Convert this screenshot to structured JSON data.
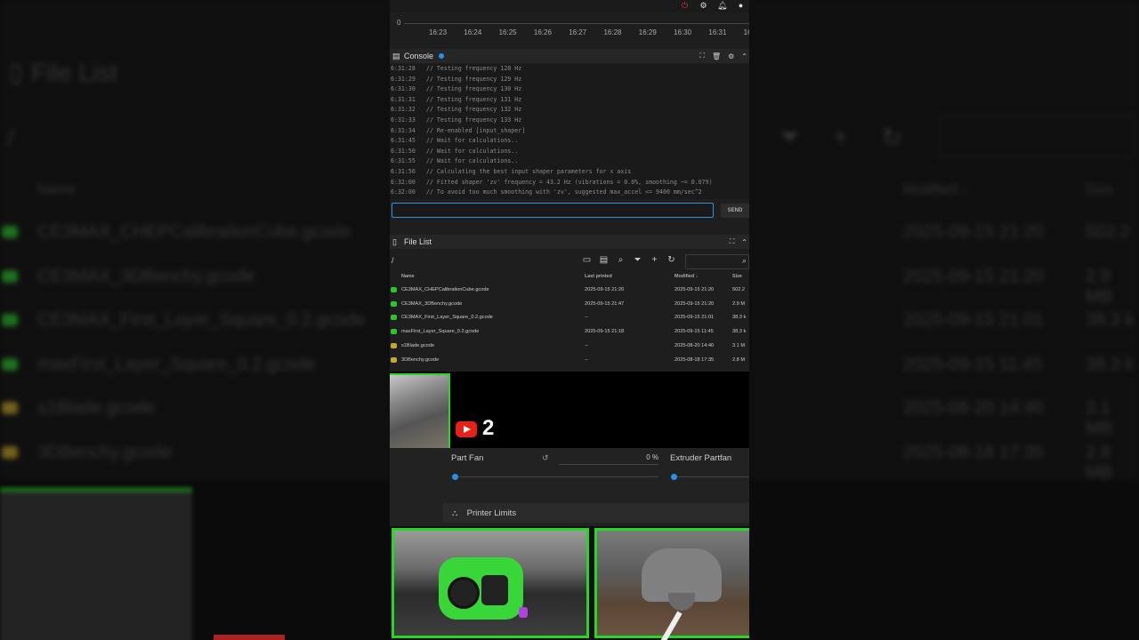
{
  "background": {
    "title": "File List",
    "path": "/",
    "header": {
      "name": "Name",
      "modified": "Modified ↓",
      "size": "Size"
    },
    "rows": [
      {
        "name": "CE3MAX_CHEPCalibrationCube.gcode",
        "modified": "2025-09-15 21:20",
        "size": "502.2",
        "color": "#2ec42e"
      },
      {
        "name": "CE3MAX_3DBenchy.gcode",
        "modified": "2025-09-15 21:20",
        "size": "2.9 MB",
        "color": "#2ec42e"
      },
      {
        "name": "CE3MAX_First_Layer_Square_0.2.gcode",
        "modified": "2025-09-15 21:01",
        "size": "38.3 k",
        "color": "#2ec42e"
      },
      {
        "name": "maxFirst_Layer_Square_0.2.gcode",
        "modified": "2025-09-15 11:45",
        "size": "38.3 k",
        "color": "#2ec42e"
      },
      {
        "name": "s1Blade.gcode",
        "modified": "2025-08-20 14:40",
        "size": "3.1 MB",
        "color": "#c8a82a"
      },
      {
        "name": "3DBenchy.gcode",
        "modified": "2025-08-18 17:35",
        "size": "2.8 MB",
        "color": "#c8a82a"
      }
    ]
  },
  "timeline": {
    "zero": "0",
    "labels": [
      "16:23",
      "16:24",
      "16:25",
      "16:26",
      "16:27",
      "16:28",
      "16:29",
      "16:30",
      "16:31",
      "16:"
    ]
  },
  "console": {
    "title": "Console",
    "send_label": "SEND",
    "input_value": "",
    "lines": [
      {
        "time": "6:31:28",
        "text": "// Testing frequency 128 Hz"
      },
      {
        "time": "6:31:29",
        "text": "// Testing frequency 129 Hz"
      },
      {
        "time": "6:31:30",
        "text": "// Testing frequency 130 Hz"
      },
      {
        "time": "6:31:31",
        "text": "// Testing frequency 131 Hz"
      },
      {
        "time": "6:31:32",
        "text": "// Testing frequency 132 Hz"
      },
      {
        "time": "6:31:33",
        "text": "// Testing frequency 133 Hz"
      },
      {
        "time": "6:31:34",
        "text": "// Re-enabled [input_shaper]"
      },
      {
        "time": "6:31:45",
        "text": "// Wait for calculations.."
      },
      {
        "time": "6:31:50",
        "text": "// Wait for calculations.."
      },
      {
        "time": "6:31:55",
        "text": "// Wait for calculations.."
      },
      {
        "time": "6:31:56",
        "text": "// Calculating the best input shaper parameters for x axis"
      },
      {
        "time": "6:32:00",
        "text": "// Fitted shaper 'zv' frequency = 43.2 Hz (vibrations = 0.0%, smoothing ~= 0.079)"
      },
      {
        "time": "6:32:00",
        "text": "// To avoid too much smoothing with 'zv', suggested max_accel <= 9400 mm/sec^2"
      }
    ]
  },
  "file_list": {
    "title": "File List",
    "path": "/",
    "header": {
      "name": "Name",
      "last_printed": "Last printed",
      "modified": "Modified ↓",
      "size": "Size"
    },
    "rows": [
      {
        "name": "CE3MAX_CHEPCalibrationCube.gcode",
        "last_printed": "2025-09-15 21:20",
        "modified": "2025-09-15 21:20",
        "size": "502.2",
        "color": "#2ec42e"
      },
      {
        "name": "CE3MAX_3DBenchy.gcode",
        "last_printed": "2025-09-15 21:47",
        "modified": "2025-09-15 21:20",
        "size": "2.9 M",
        "color": "#2ec42e"
      },
      {
        "name": "CE3MAX_First_Layer_Square_0.2.gcode",
        "last_printed": "--",
        "modified": "2025-09-15 21:01",
        "size": "38.3 k",
        "color": "#2ec42e"
      },
      {
        "name": "maxFirst_Layer_Square_0.2.gcode",
        "last_printed": "2025-09-15 21:18",
        "modified": "2025-09-15 11:45",
        "size": "38.3 k",
        "color": "#2ec42e"
      },
      {
        "name": "s1Blade.gcode",
        "last_printed": "--",
        "modified": "2025-08-20 14:40",
        "size": "3.1 M",
        "color": "#c8a82a"
      },
      {
        "name": "3DBenchy.gcode",
        "last_printed": "--",
        "modified": "2025-08-18 17:35",
        "size": "2.8 M",
        "color": "#c8a82a"
      }
    ]
  },
  "overlay": {
    "subscriber_number": "2"
  },
  "fans": {
    "part_fan_label": "Part Fan",
    "part_fan_value": "0 %",
    "part_fan_level": 0,
    "extruder_fan_label": "Extruder Partfan"
  },
  "printer_limits": {
    "label": "Printer Limits"
  },
  "colors": {
    "accent": "#2a8fe8",
    "green_frame": "#27d627",
    "alert_red": "#e33333"
  }
}
